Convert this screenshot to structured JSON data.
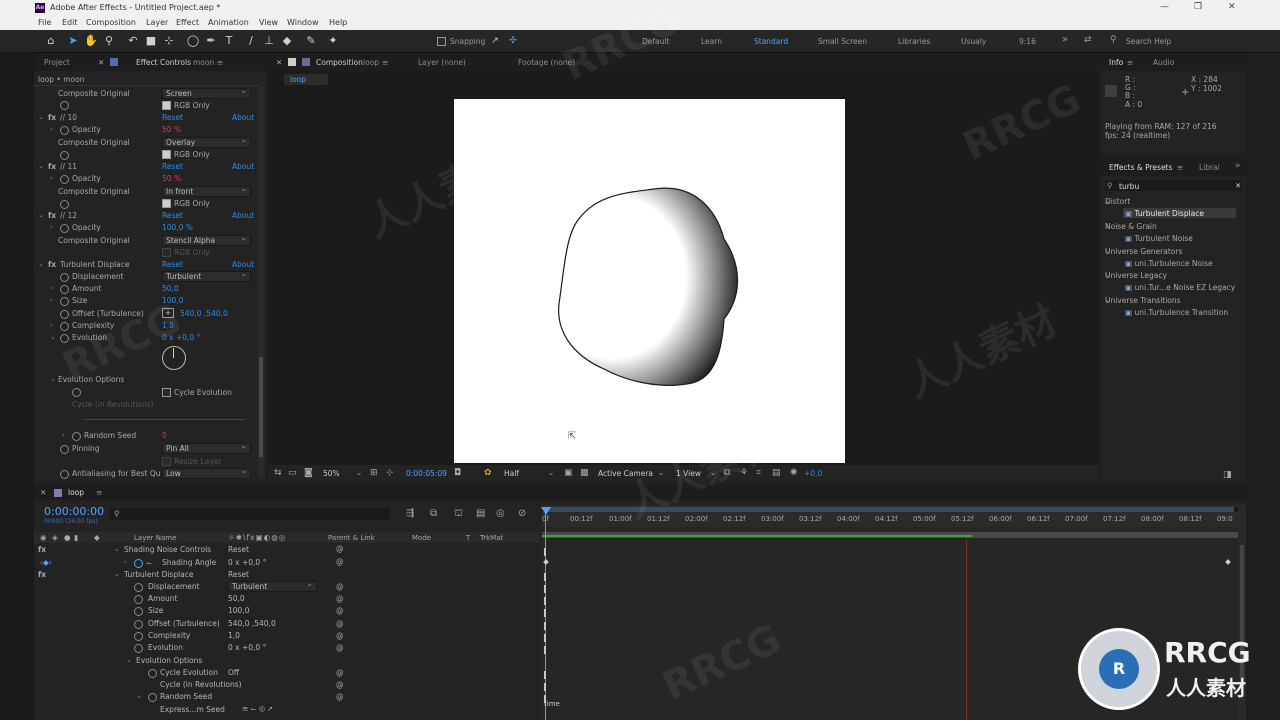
{
  "title_bar": {
    "app_badge": "Ae",
    "title": "Adobe After Effects - Untitled Project.aep *"
  },
  "menu": [
    "File",
    "Edit",
    "Composition",
    "Layer",
    "Effect",
    "Animation",
    "View",
    "Window",
    "Help"
  ],
  "toolbar": {
    "snapping_label": "Snapping",
    "workspaces": [
      "Default",
      "Learn",
      "Standard",
      "Small Screen",
      "Libraries",
      "Usualy",
      "9:16"
    ],
    "active_workspace": "Standard",
    "search_help": "Search Help"
  },
  "left_panel": {
    "tab_project": "Project",
    "tab_effect_controls": "Effect Controls",
    "tab_effect_controls_target": "moon",
    "header": "loop • moon",
    "rows": {
      "composite_original_1": "Composite Original",
      "composite_value_1": "Screen",
      "rgb_only_1": "RGB Only",
      "fx10": "// 10",
      "reset": "Reset",
      "about": "About",
      "opacity": "Opacity",
      "opacity_val_10": "50 %",
      "composite_original_2": "Composite Original",
      "composite_value_2": "Overlay",
      "rgb_only_2": "RGB Only",
      "fx11": "// 11",
      "opacity_val_11": "50 %",
      "composite_original_3": "Composite Original",
      "composite_value_3": "In front",
      "rgb_only_3": "RGB Only",
      "fx12": "// 12",
      "opacity_val_12": "100,0 %",
      "composite_original_4": "Composite Original",
      "composite_value_4": "Stencil Alpha",
      "rgb_only_4": "RGB Only",
      "turbulent_displace": "Turbulent Displace",
      "displacement": "Displacement",
      "displacement_val": "Turbulent",
      "amount": "Amount",
      "amount_val": "50,0",
      "size": "Size",
      "size_val": "100,0",
      "offset": "Offset (Turbulence)",
      "offset_val": "540,0 ,540,0",
      "complexity": "Complexity",
      "complexity_val": "1,0",
      "evolution": "Evolution",
      "evolution_val": "0 x +0,0 °",
      "evolution_options": "Evolution Options",
      "cycle_evolution": "Cycle Evolution",
      "cycle_in_revolutions": "Cycle (in Revolutions)",
      "random_seed": "Random Seed",
      "random_seed_val": "0",
      "pinning": "Pinning",
      "pinning_val": "Pin All",
      "resize_layer": "Resize Layer",
      "antialiasing": "Antialiasing for Best Qu",
      "antialiasing_val": "Low"
    }
  },
  "viewer": {
    "tab_composition": "Composition",
    "tab_composition_name": "loop",
    "tab_layer": "Layer (none)",
    "tab_footage": "Footage (none)",
    "breadcrumb": "loop",
    "zoom": "50%",
    "timecode": "0:00:05:09",
    "resolution": "Half",
    "camera": "Active Camera",
    "views": "1 View",
    "exposure": "+0,0"
  },
  "info_panel": {
    "tab_info": "Info",
    "tab_audio": "Audio",
    "r": "R :",
    "g": "G :",
    "b": "B :",
    "a": "A : 0",
    "x": "X : 284",
    "y": "Y : 1002",
    "ram_line1": "Playing from RAM: 127 of 216",
    "ram_line2": "fps: 24 (realtime)"
  },
  "effects_presets": {
    "tab": "Effects & Presets",
    "tab2": "Librai",
    "search": "turbu",
    "tree": [
      {
        "category": "Distort",
        "items": [
          "Turbulent Displace"
        ]
      },
      {
        "category": "Noise & Grain",
        "items": [
          "Turbulent Noise"
        ]
      },
      {
        "category": "Universe Generators",
        "items": [
          "uni.Turbulence Noise"
        ]
      },
      {
        "category": "Universe Legacy",
        "items": [
          "uni.Tur...e Noise EZ Legacy"
        ]
      },
      {
        "category": "Universe Transitions",
        "items": [
          "uni.Turbulence Transition"
        ]
      }
    ],
    "selected": "Turbulent Displace"
  },
  "timeline": {
    "comp_tab": "loop",
    "timecode": "0:00:00:00",
    "timecode_sub": "00000 (24.00 fps)",
    "columns": {
      "layer_name": "Layer Name",
      "parent": "Parent & Link",
      "mode": "Mode",
      "t": "T",
      "trkmat": "TrkMat"
    },
    "ruler": [
      "0f",
      "00:12f",
      "01:00f",
      "01:12f",
      "02:00f",
      "02:12f",
      "03:00f",
      "03:12f",
      "04:00f",
      "04:12f",
      "05:00f",
      "05:12f",
      "06:00f",
      "06:12f",
      "07:00f",
      "07:12f",
      "08:00f",
      "08:12f",
      "09:0"
    ],
    "rows": [
      {
        "label": "Shading Noise Controls",
        "value": "Reset"
      },
      {
        "label": "Shading Angle",
        "value": "0 x +0,0 °"
      },
      {
        "label": "Turbulent Displace",
        "value": "Reset"
      },
      {
        "label": "Displacement",
        "value": "Turbulent"
      },
      {
        "label": "Amount",
        "value": "50,0"
      },
      {
        "label": "Size",
        "value": "100,0"
      },
      {
        "label": "Offset (Turbulence)",
        "value": "540,0 ,540,0"
      },
      {
        "label": "Complexity",
        "value": "1,0"
      },
      {
        "label": "Evolution",
        "value": "0 x +0,0 °"
      },
      {
        "label": "Evolution Options",
        "value": ""
      },
      {
        "label": "Cycle Evolution",
        "value": "Off"
      },
      {
        "label": "Cycle (in Revolutions)",
        "value": ""
      },
      {
        "label": "Random Seed",
        "value": ""
      },
      {
        "label": "Express...m Seed",
        "value": ""
      }
    ],
    "expression_text": "time"
  },
  "watermarks": {
    "rrcg": "RRCG",
    "chinese": "人人素材"
  },
  "colors": {
    "accent": "#2d8ceb",
    "keyframe_red": "#c8434b",
    "work_area_green": "#3fa33f"
  }
}
